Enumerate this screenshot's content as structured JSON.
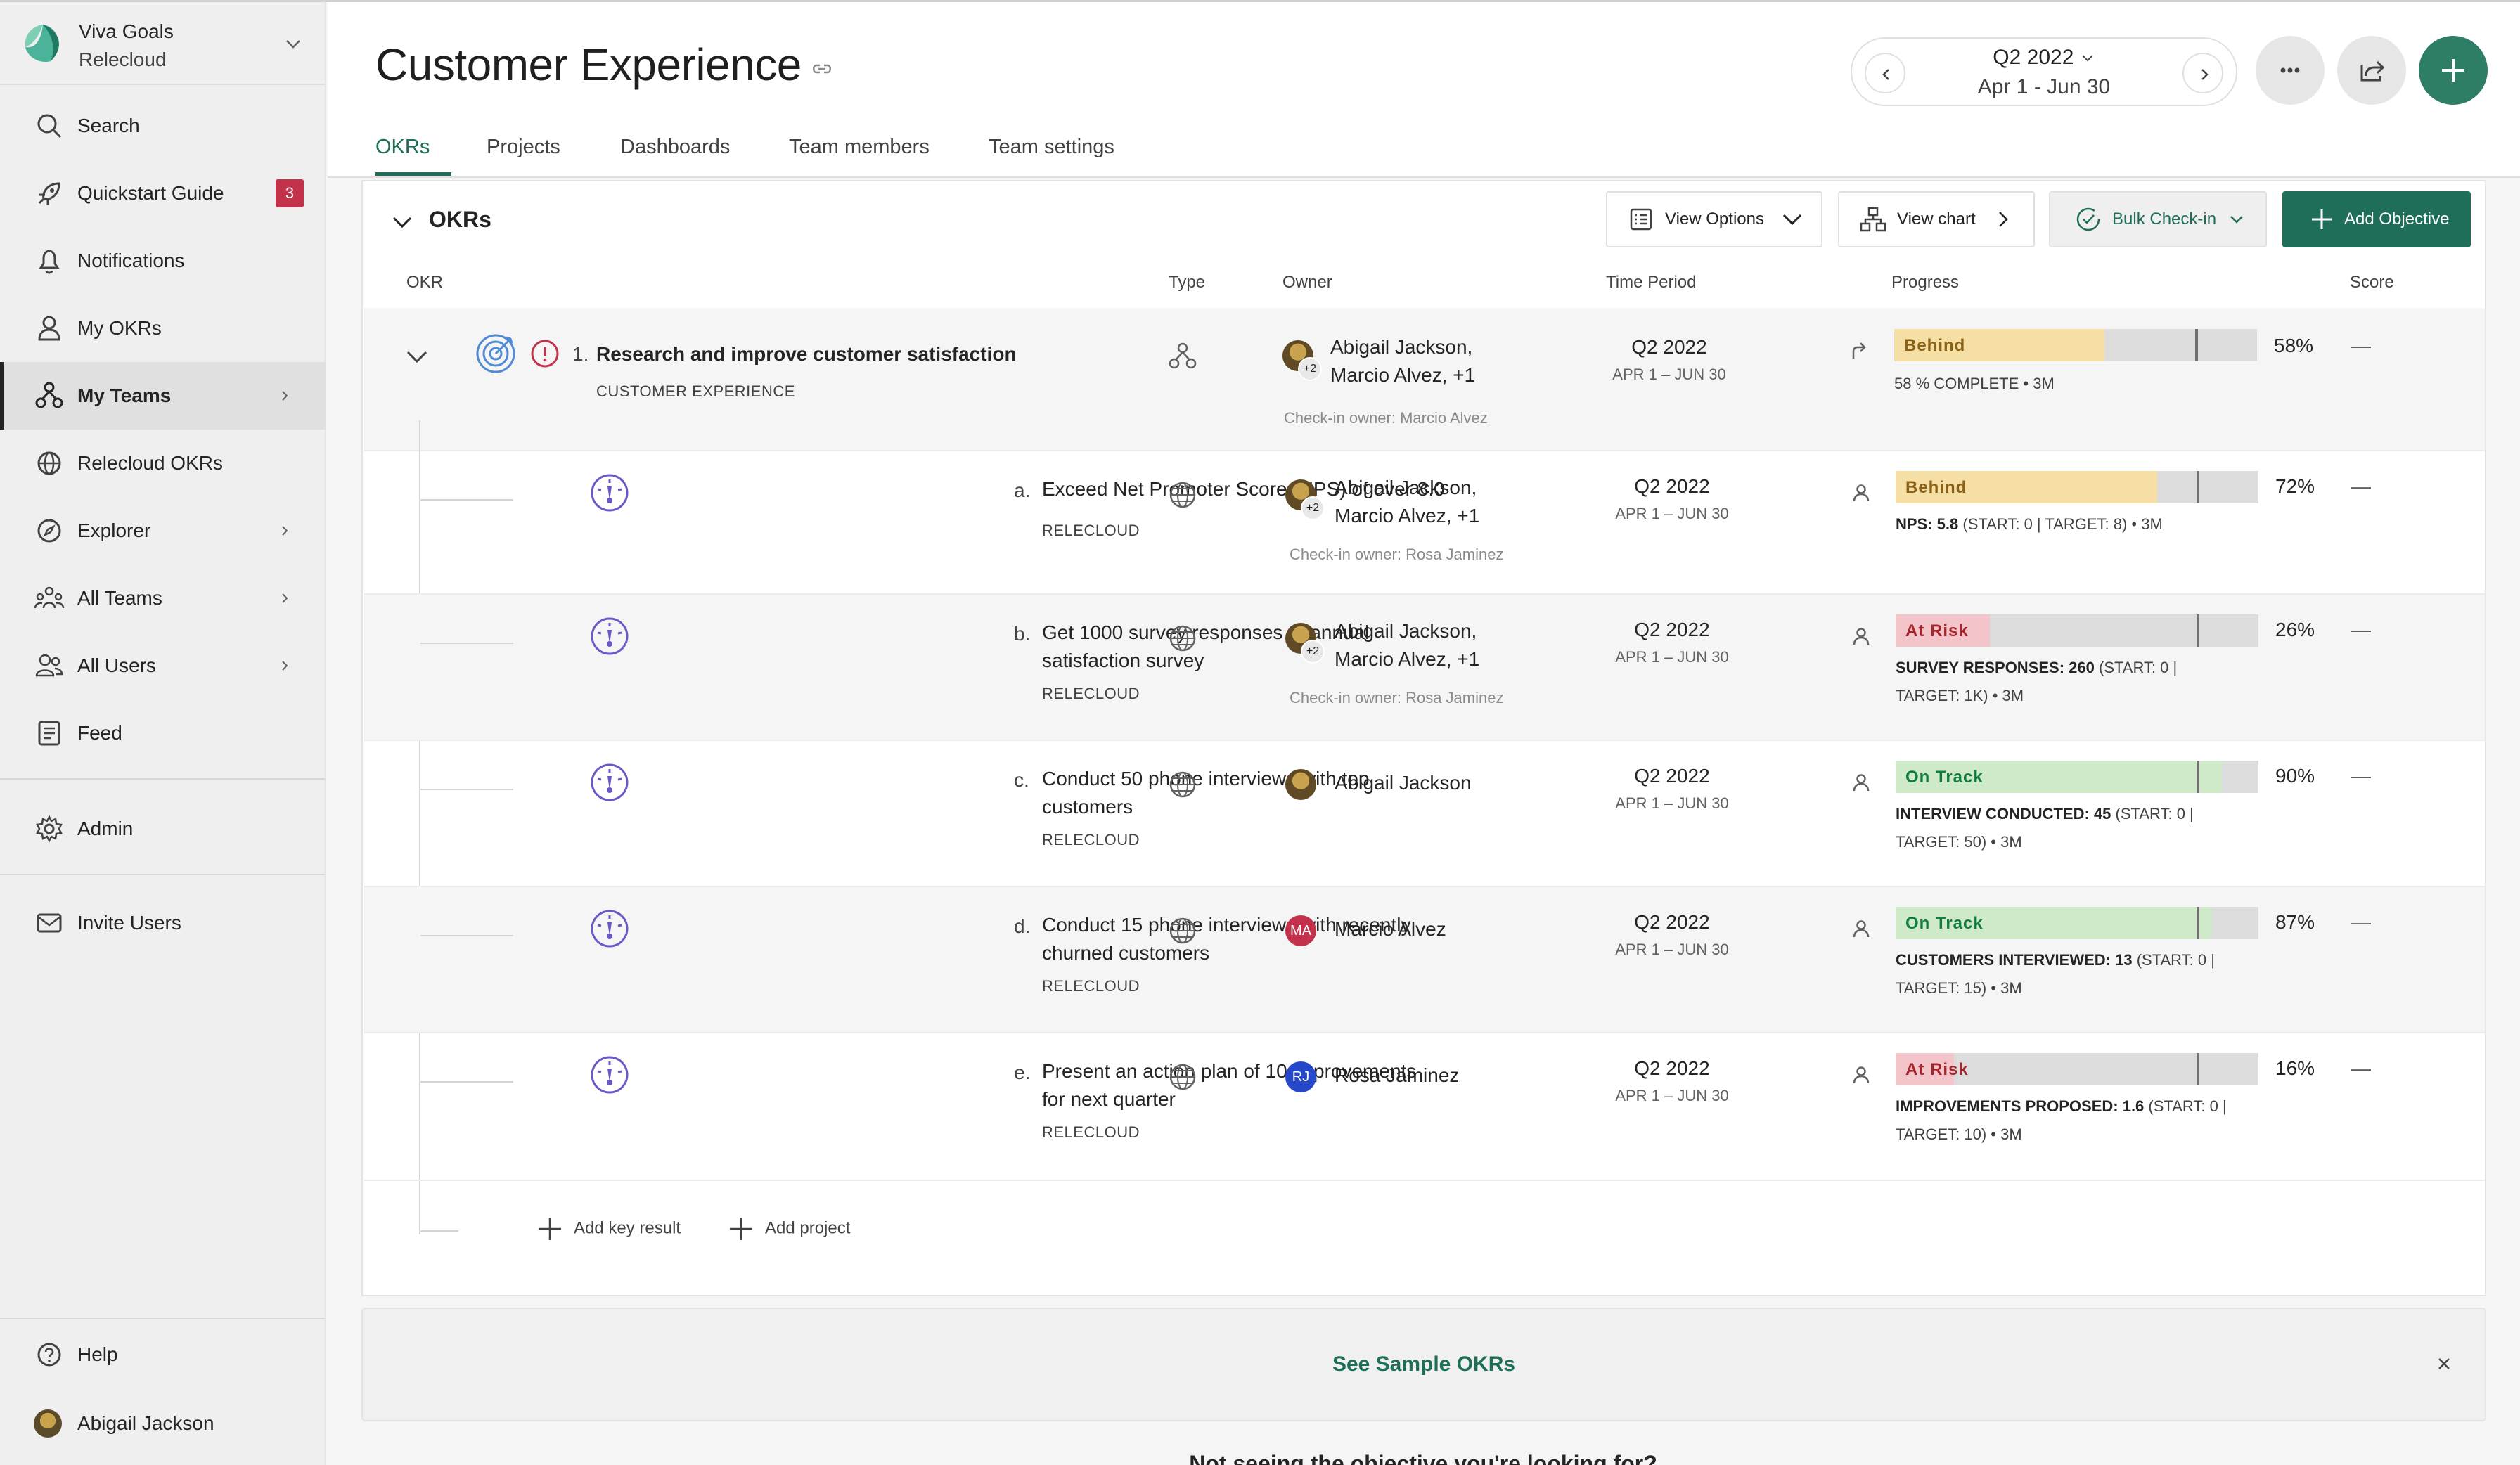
{
  "brand": {
    "name": "Viva Goals",
    "org": "Relecloud"
  },
  "sidebar": {
    "items": [
      {
        "label": "Search"
      },
      {
        "label": "Quickstart Guide",
        "badge": "3"
      },
      {
        "label": "Notifications"
      },
      {
        "label": "My OKRs"
      },
      {
        "label": "My Teams"
      },
      {
        "label": "Relecloud OKRs"
      },
      {
        "label": "Explorer"
      },
      {
        "label": "All Teams"
      },
      {
        "label": "All Users"
      },
      {
        "label": "Feed"
      },
      {
        "label": "Admin"
      },
      {
        "label": "Invite Users"
      },
      {
        "label": "Help"
      },
      {
        "label": "Abigail Jackson"
      }
    ]
  },
  "header": {
    "title": "Customer Experience",
    "period": {
      "quarter": "Q2 2022",
      "range": "Apr 1 - Jun 30"
    },
    "tabs": [
      "OKRs",
      "Projects",
      "Dashboards",
      "Team members",
      "Team settings"
    ]
  },
  "toolbar": {
    "section_title": "OKRs",
    "view_options": "View Options",
    "view_chart": "View chart",
    "bulk_checkin": "Bulk Check-in",
    "add_objective": "Add Objective"
  },
  "columns": {
    "okr": "OKR",
    "type": "Type",
    "owner": "Owner",
    "time_period": "Time Period",
    "progress": "Progress",
    "score": "Score"
  },
  "objective": {
    "index": "1.",
    "title": "Research and improve customer satisfaction",
    "team": "CUSTOMER EXPERIENCE",
    "owner_line1": "Abigail Jackson,",
    "owner_line2": "Marcio Alvez, +1",
    "owner_plus": "+2",
    "checkin_owner": "Check-in owner: Marcio Alvez",
    "quarter": "Q2 2022",
    "range": "APR 1 – JUN 30",
    "status": "Behind",
    "progress": 0.58,
    "percent": "58%",
    "detail": "58 % COMPLETE • 3M",
    "score": "—"
  },
  "key_results": [
    {
      "index": "a.",
      "title_lines": [
        "Exceed Net Promoter Score (NPS) of over 8.0",
        ""
      ],
      "team": "RELECLOUD",
      "owner_line1": "Abigail Jackson,",
      "owner_line2": "Marcio Alvez, +1",
      "owner_plus": "+2",
      "checkin_owner": "Check-in owner: Rosa Jaminez",
      "quarter": "Q2 2022",
      "range": "APR 1 – JUN 30",
      "status": "Behind",
      "status_kind": "behind",
      "progress": 0.72,
      "percent": "72%",
      "metric": "NPS: 5.8",
      "detail_line1": " (START: 0 | TARGET: 8) • 3M",
      "detail_line2": "",
      "score": "—"
    },
    {
      "index": "b.",
      "title_lines": [
        "Get 1000 survey responses to annual",
        "satisfaction survey"
      ],
      "team": "RELECLOUD",
      "owner_line1": "Abigail Jackson,",
      "owner_line2": "Marcio Alvez, +1",
      "owner_plus": "+2",
      "checkin_owner": "Check-in owner: Rosa Jaminez",
      "quarter": "Q2 2022",
      "range": "APR 1 – JUN 30",
      "status": "At Risk",
      "status_kind": "risk",
      "progress": 0.26,
      "percent": "26%",
      "metric": "SURVEY RESPONSES: 260",
      "detail_line1": " (START: 0 |",
      "detail_line2": "TARGET: 1K) • 3M",
      "score": "—"
    },
    {
      "index": "c.",
      "title_lines": [
        "Conduct 50 phone interviews with top",
        "customers"
      ],
      "team": "RELECLOUD",
      "owner_line1": "Abigail Jackson",
      "owner_line2": "",
      "owner_plus": "",
      "owner_initials": "",
      "checkin_owner": "",
      "quarter": "Q2 2022",
      "range": "APR 1 – JUN 30",
      "status": "On Track",
      "status_kind": "track",
      "progress": 0.9,
      "percent": "90%",
      "metric": "INTERVIEW CONDUCTED: 45",
      "detail_line1": " (START: 0 |",
      "detail_line2": "TARGET: 50) • 3M",
      "score": "—"
    },
    {
      "index": "d.",
      "title_lines": [
        "Conduct 15 phone interviews with recently",
        "churned customers"
      ],
      "team": "RELECLOUD",
      "owner_line1": "Marcio Alvez",
      "owner_line2": "",
      "owner_plus": "",
      "owner_initials": "MA",
      "checkin_owner": "",
      "quarter": "Q2 2022",
      "range": "APR 1 – JUN 30",
      "status": "On Track",
      "status_kind": "track",
      "progress": 0.87,
      "percent": "87%",
      "metric": "CUSTOMERS INTERVIEWED: 13",
      "detail_line1": " (START: 0 |",
      "detail_line2": "TARGET: 15) • 3M",
      "score": "—"
    },
    {
      "index": "e.",
      "title_lines": [
        "Present an action plan of 10 improvements",
        "for next quarter"
      ],
      "team": "RELECLOUD",
      "owner_line1": "Rosa Jaminez",
      "owner_line2": "",
      "owner_plus": "",
      "owner_initials": "RJ",
      "checkin_owner": "",
      "quarter": "Q2 2022",
      "range": "APR 1 – JUN 30",
      "status": "At Risk",
      "status_kind": "risk",
      "progress": 0.16,
      "percent": "16%",
      "metric": "IMPROVEMENTS PROPOSED: 1.6",
      "detail_line1": " (START: 0 |",
      "detail_line2": "TARGET: 10) • 3M",
      "score": "—"
    }
  ],
  "actions": {
    "add_key_result": "Add key result",
    "add_project": "Add project"
  },
  "banner": {
    "link": "See Sample OKRs",
    "footer": "Not seeing the objective you're looking for?"
  },
  "colors": {
    "accent": "#1e6e59",
    "behind": "#f6dfa5",
    "at_risk": "#f4c4cb",
    "on_track": "#cfeac9"
  }
}
